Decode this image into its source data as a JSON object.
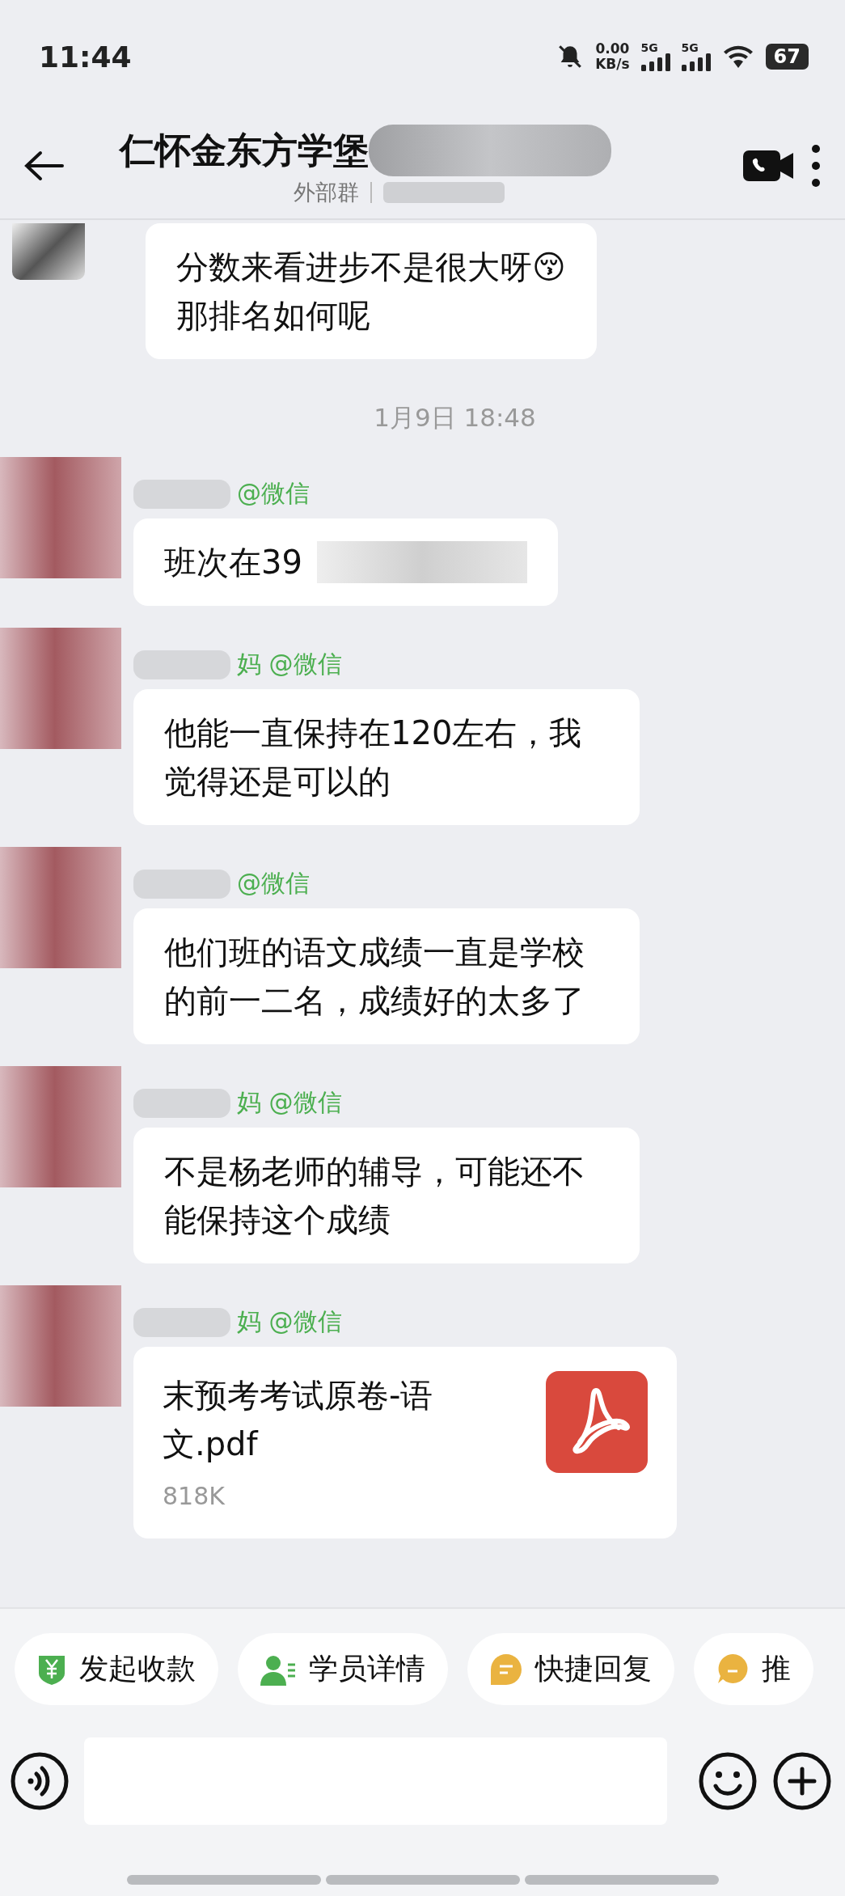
{
  "status_bar": {
    "time": "11:44",
    "net_speed": "0.00",
    "net_unit": "KB/s",
    "sim_1": "5G",
    "sim_2": "5G",
    "battery": "67"
  },
  "header": {
    "title": "仁怀金东方学堡",
    "subtitle": "外部群"
  },
  "messages": [
    {
      "kind": "text",
      "text": "分数来看进步不是很大呀😚\n那排名如何呢"
    },
    {
      "kind": "time",
      "text": "1月9日  18:48"
    },
    {
      "kind": "text",
      "sender": "@微信",
      "text": "班次在39",
      "redacted": true
    },
    {
      "kind": "text",
      "sender": "妈 @微信",
      "text": "他能一直保持在120左右，我觉得还是可以的"
    },
    {
      "kind": "text",
      "sender": "@微信",
      "text": "他们班的语文成绩一直是学校的前一二名，成绩好的太多了"
    },
    {
      "kind": "text",
      "sender": "妈 @微信",
      "text": "不是杨老师的辅导，可能还不能保持这个成绩"
    },
    {
      "kind": "file",
      "sender": "妈 @微信",
      "file_name": "末预考考试原卷-语文.pdf",
      "file_size": "818K"
    }
  ],
  "quick_actions": [
    {
      "label": "发起收款"
    },
    {
      "label": "学员详情"
    },
    {
      "label": "快捷回复"
    },
    {
      "label": "推"
    }
  ]
}
